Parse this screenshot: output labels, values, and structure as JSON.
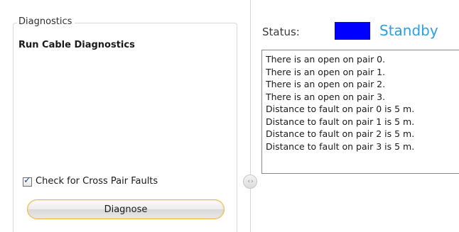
{
  "diagnostics": {
    "group_title": "Diagnostics",
    "heading": "Run Cable Diagnostics",
    "checkbox_label": "Check for Cross Pair Faults",
    "checkbox_checked": true,
    "diagnose_button_label": "Diagnose"
  },
  "splitter": {
    "icon": "collapse-expand-icon",
    "glyph": "‹›"
  },
  "status": {
    "label": "Status:",
    "value": "Standby",
    "indicator_color": "#0000ff",
    "value_color": "#2b9fe0"
  },
  "log": {
    "lines": [
      "There is an open on pair 0.",
      "There is an open on pair 1.",
      "There is an open on pair 2.",
      "There is an open on pair 3.",
      "Distance to fault on pair 0 is 5 m.",
      "Distance to fault on pair 1 is 5 m.",
      "Distance to fault on pair 2 is 5 m.",
      "Distance to fault on pair 3 is 5 m."
    ]
  }
}
